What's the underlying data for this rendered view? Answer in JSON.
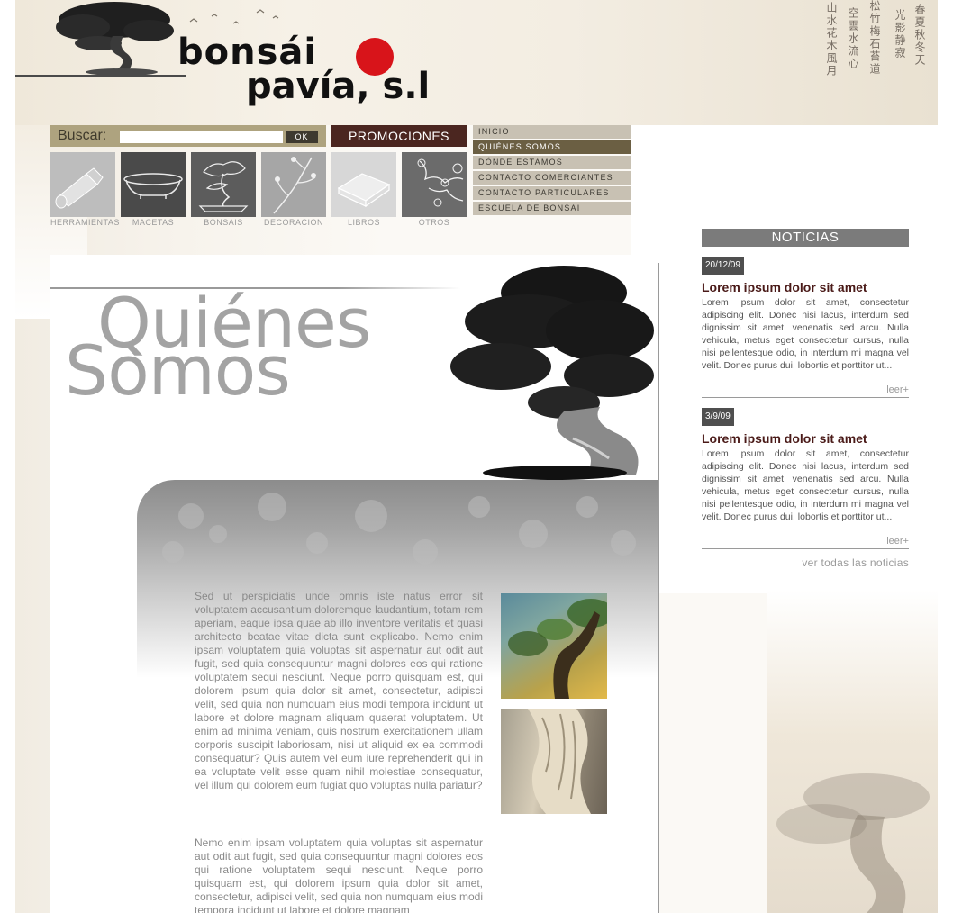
{
  "brand": {
    "line1": "bonsái",
    "line2": "pavía, s.l"
  },
  "search": {
    "label": "Buscar:",
    "value": "",
    "placeholder": "",
    "button": "OK"
  },
  "promo": {
    "label": "PROMOCIONES"
  },
  "categories": [
    {
      "label": "HERRAMIENTAS",
      "icon": "tube-icon"
    },
    {
      "label": "MACETAS",
      "icon": "pot-icon"
    },
    {
      "label": "BONSAIS",
      "icon": "bonsai-icon"
    },
    {
      "label": "DECORACION",
      "icon": "branch-icon"
    },
    {
      "label": "LIBROS",
      "icon": "book-icon"
    },
    {
      "label": "OTROS",
      "icon": "leaves-icon"
    }
  ],
  "menu": [
    {
      "label": "INICIO",
      "active": false
    },
    {
      "label": "QUIÉNES SOMOS",
      "active": true
    },
    {
      "label": "DÓNDE ESTAMOS",
      "active": false
    },
    {
      "label": "CONTACTO COMERCIANTES",
      "active": false
    },
    {
      "label": "CONTACTO PARTICULARES",
      "active": false
    },
    {
      "label": "ESCUELA DE BONSAI",
      "active": false
    }
  ],
  "main": {
    "title_line1": "Quiénes",
    "title_line2": "Somos",
    "paragraph1": "Sed ut perspiciatis unde omnis iste natus error sit voluptatem accusantium doloremque laudantium, totam rem aperiam, eaque ipsa quae ab illo inventore veritatis et quasi architecto beatae vitae dicta sunt explicabo. Nemo enim ipsam voluptatem quia voluptas sit aspernatur aut odit aut fugit, sed quia consequuntur magni dolores eos qui ratione voluptatem sequi nesciunt. Neque porro quisquam est, qui dolorem ipsum quia dolor sit amet, consectetur, adipisci velit, sed quia non numquam eius modi tempora incidunt ut labore et dolore magnam aliquam quaerat voluptatem. Ut enim ad minima veniam, quis nostrum exercitationem ullam corporis suscipit laboriosam, nisi ut aliquid ex ea commodi consequatur? Quis autem vel eum iure reprehenderit qui in ea voluptate velit esse quam nihil molestiae consequatur, vel illum qui dolorem eum fugiat quo voluptas nulla pariatur?",
    "paragraph2": "Nemo enim ipsam voluptatem quia voluptas sit aspernatur aut odit aut fugit, sed quia consequuntur magni dolores eos qui ratione voluptatem sequi nesciunt. Neque porro quisquam est, qui dolorem ipsum quia dolor sit amet, consectetur, adipisci velit, sed quia non numquam eius modi tempora incidunt ut labore et dolore magnam"
  },
  "news": {
    "heading": "NOTICIAS",
    "items": [
      {
        "date": "20/12/09",
        "title": "Lorem ipsum dolor sit amet",
        "body": "Lorem ipsum dolor sit amet, consectetur adipiscing elit. Donec nisi lacus, interdum sed dignissim sit amet, venenatis sed arcu. Nulla vehicula, metus eget consectetur cursus, nulla nisi pellentesque odio, in interdum mi magna vel velit. Donec purus dui, lobortis et porttitor ut...",
        "more": "leer+"
      },
      {
        "date": "3/9/09",
        "title": "Lorem ipsum dolor sit amet",
        "body": "Lorem ipsum dolor sit amet, consectetur adipiscing elit. Donec nisi lacus, interdum sed dignissim sit amet, venenatis sed arcu. Nulla vehicula, metus eget consectetur cursus, nulla nisi pellentesque odio, in interdum mi magna vel velit. Donec purus dui, lobortis et porttitor ut...",
        "more": "leer+"
      }
    ],
    "all_link": "ver todas las noticias"
  },
  "colors": {
    "accent_red": "#d8141a",
    "promo_bg": "#4b2620",
    "menu_active": "#6b5f43",
    "news_title": "#4a1a18"
  }
}
